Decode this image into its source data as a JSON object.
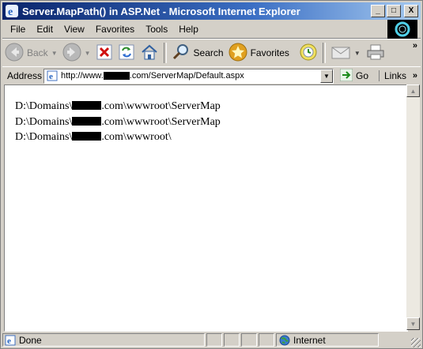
{
  "window": {
    "title": "Server.MapPath() in ASP.Net - Microsoft Internet Explorer",
    "buttons": [
      "_",
      "□",
      "X"
    ]
  },
  "menu": {
    "items": [
      "File",
      "Edit",
      "View",
      "Favorites",
      "Tools",
      "Help"
    ]
  },
  "toolbar": {
    "back_label": "Back",
    "search_label": "Search",
    "favorites_label": "Favorites",
    "icons": [
      "back-icon",
      "forward-icon",
      "stop-icon",
      "refresh-icon",
      "home-icon",
      "search-icon",
      "favorites-icon",
      "media-icon",
      "mail-icon",
      "print-icon"
    ],
    "overflow": "»"
  },
  "address": {
    "label": "Address",
    "url_prefix": "http://www.",
    "url_suffix": ".com/ServerMap/Default.aspx",
    "go_label": "Go",
    "links_label": "Links",
    "links_overflow": "»"
  },
  "content": {
    "lines": [
      {
        "prefix": "D:\\Domains\\",
        "suffix": ".com\\wwwroot\\ServerMap"
      },
      {
        "prefix": "D:\\Domains\\",
        "suffix": ".com\\wwwroot\\ServerMap"
      },
      {
        "prefix": "D:\\Domains\\",
        "suffix": ".com\\wwwroot\\"
      }
    ]
  },
  "status": {
    "text": "Done",
    "zone": "Internet"
  },
  "colors": {
    "title_start": "#0a246a",
    "title_end": "#a6caf0",
    "chrome": "#d4d0c8"
  }
}
